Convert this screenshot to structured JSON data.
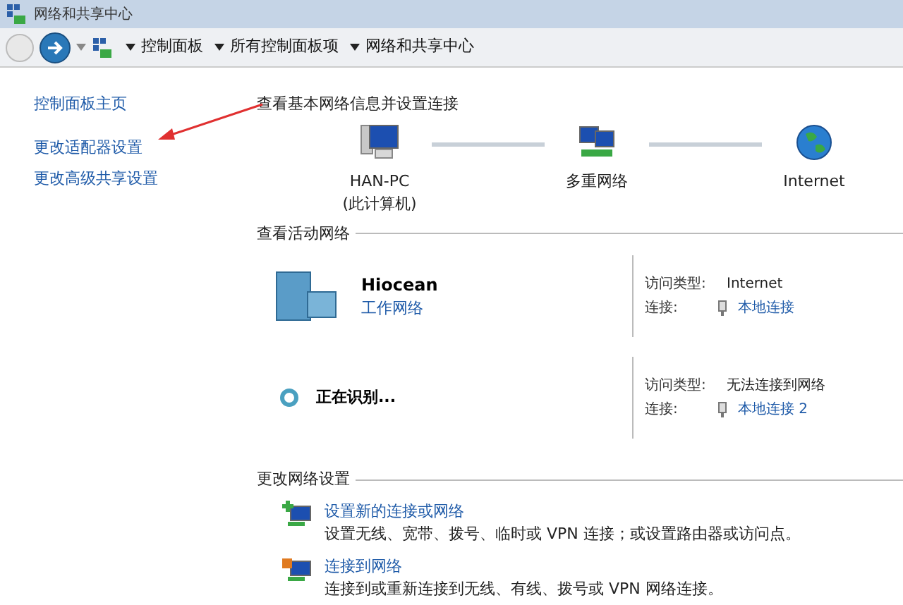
{
  "window": {
    "title": "网络和共享中心"
  },
  "address_bar": {
    "breadcrumbs": [
      "控制面板",
      "所有控制面板项",
      "网络和共享中心"
    ]
  },
  "sidebar": {
    "links": [
      "控制面板主页",
      "更改适配器设置",
      "更改高级共享设置"
    ]
  },
  "basic_info": {
    "heading": "查看基本网络信息并设置连接",
    "nodes": [
      {
        "kind": "computer",
        "label": "HAN-PC",
        "sublabel": "(此计算机)"
      },
      {
        "kind": "multi",
        "label": "多重网络"
      },
      {
        "kind": "globe",
        "label": "Internet"
      }
    ]
  },
  "active_networks": {
    "heading": "查看活动网络",
    "networks": [
      {
        "kind": "identified",
        "name": "Hiocean",
        "category": "工作网络",
        "access_label": "访问类型:",
        "access": "Internet",
        "connection_label": "连接:",
        "connection": "本地连接"
      },
      {
        "kind": "identifying",
        "name": "正在识别...",
        "access_label": "访问类型:",
        "access": "无法连接到网络",
        "connection_label": "连接:",
        "connection": "本地连接 2"
      }
    ]
  },
  "change_settings": {
    "heading": "更改网络设置",
    "tasks": [
      {
        "title": "设置新的连接或网络",
        "description": "设置无线、宽带、拨号、临时或 VPN 连接；或设置路由器或访问点。"
      },
      {
        "title": "连接到网络",
        "description": "连接到或重新连接到无线、有线、拨号或 VPN 网络连接。"
      }
    ]
  }
}
